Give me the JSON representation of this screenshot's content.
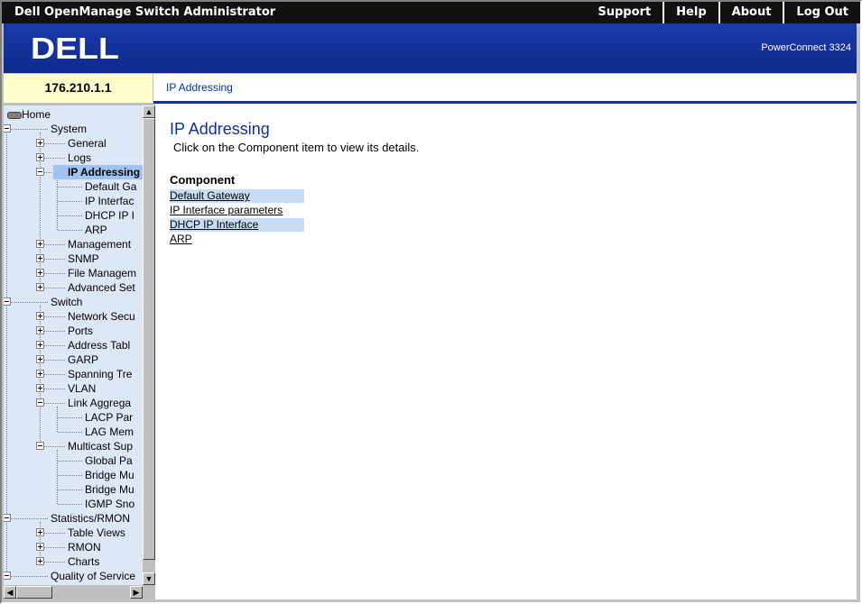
{
  "header": {
    "app_title": "Dell OpenManage Switch Administrator",
    "links": [
      "Support",
      "Help",
      "About",
      "Log Out"
    ],
    "logo_text": "DELL",
    "model": "PowerConnect 3324"
  },
  "device_ip": "176.210.1.1",
  "breadcrumb": "IP Addressing",
  "nav_tree": [
    {
      "label": "Home",
      "level": 0,
      "kind": "root"
    },
    {
      "label": "System",
      "level": 1,
      "kind": "open"
    },
    {
      "label": "General",
      "level": 2,
      "kind": "closed"
    },
    {
      "label": "Logs",
      "level": 2,
      "kind": "closed"
    },
    {
      "label": "IP Addressing",
      "level": 2,
      "kind": "open",
      "selected": true
    },
    {
      "label": "Default Ga",
      "level": 3,
      "kind": "leaf"
    },
    {
      "label": "IP Interfac",
      "level": 3,
      "kind": "leaf"
    },
    {
      "label": "DHCP IP I",
      "level": 3,
      "kind": "leaf"
    },
    {
      "label": "ARP",
      "level": 3,
      "kind": "leaf"
    },
    {
      "label": "Management",
      "level": 2,
      "kind": "closed"
    },
    {
      "label": "SNMP",
      "level": 2,
      "kind": "closed"
    },
    {
      "label": "File Managem",
      "level": 2,
      "kind": "closed"
    },
    {
      "label": "Advanced Set",
      "level": 2,
      "kind": "closed"
    },
    {
      "label": "Switch",
      "level": 1,
      "kind": "open"
    },
    {
      "label": "Network Secu",
      "level": 2,
      "kind": "closed"
    },
    {
      "label": "Ports",
      "level": 2,
      "kind": "closed"
    },
    {
      "label": "Address Tabl",
      "level": 2,
      "kind": "closed"
    },
    {
      "label": "GARP",
      "level": 2,
      "kind": "closed"
    },
    {
      "label": "Spanning Tre",
      "level": 2,
      "kind": "closed"
    },
    {
      "label": "VLAN",
      "level": 2,
      "kind": "closed"
    },
    {
      "label": "Link Aggrega",
      "level": 2,
      "kind": "open"
    },
    {
      "label": "LACP Par",
      "level": 3,
      "kind": "leaf"
    },
    {
      "label": "LAG Mem",
      "level": 3,
      "kind": "leaf"
    },
    {
      "label": "Multicast Sup",
      "level": 2,
      "kind": "open"
    },
    {
      "label": "Global Pa",
      "level": 3,
      "kind": "leaf"
    },
    {
      "label": "Bridge Mu",
      "level": 3,
      "kind": "leaf"
    },
    {
      "label": "Bridge Mu",
      "level": 3,
      "kind": "leaf"
    },
    {
      "label": "IGMP Sno",
      "level": 3,
      "kind": "leaf"
    },
    {
      "label": "Statistics/RMON",
      "level": 1,
      "kind": "open"
    },
    {
      "label": "Table Views",
      "level": 2,
      "kind": "closed"
    },
    {
      "label": "RMON",
      "level": 2,
      "kind": "closed"
    },
    {
      "label": "Charts",
      "level": 2,
      "kind": "closed"
    },
    {
      "label": "Quality of Service",
      "level": 1,
      "kind": "open"
    }
  ],
  "main": {
    "title": "IP Addressing",
    "description": "Click on the Component item to view its details.",
    "component_header": "Component",
    "components": [
      "Default Gateway",
      "IP Interface parameters",
      "DHCP IP Interface",
      "ARP"
    ]
  },
  "colors": {
    "banner": "#14329c",
    "title_blue": "#0f2f9c",
    "nav_bg": "#dde8f7",
    "selected": "#9fc3ee",
    "ip_bg": "#ffffcc"
  }
}
